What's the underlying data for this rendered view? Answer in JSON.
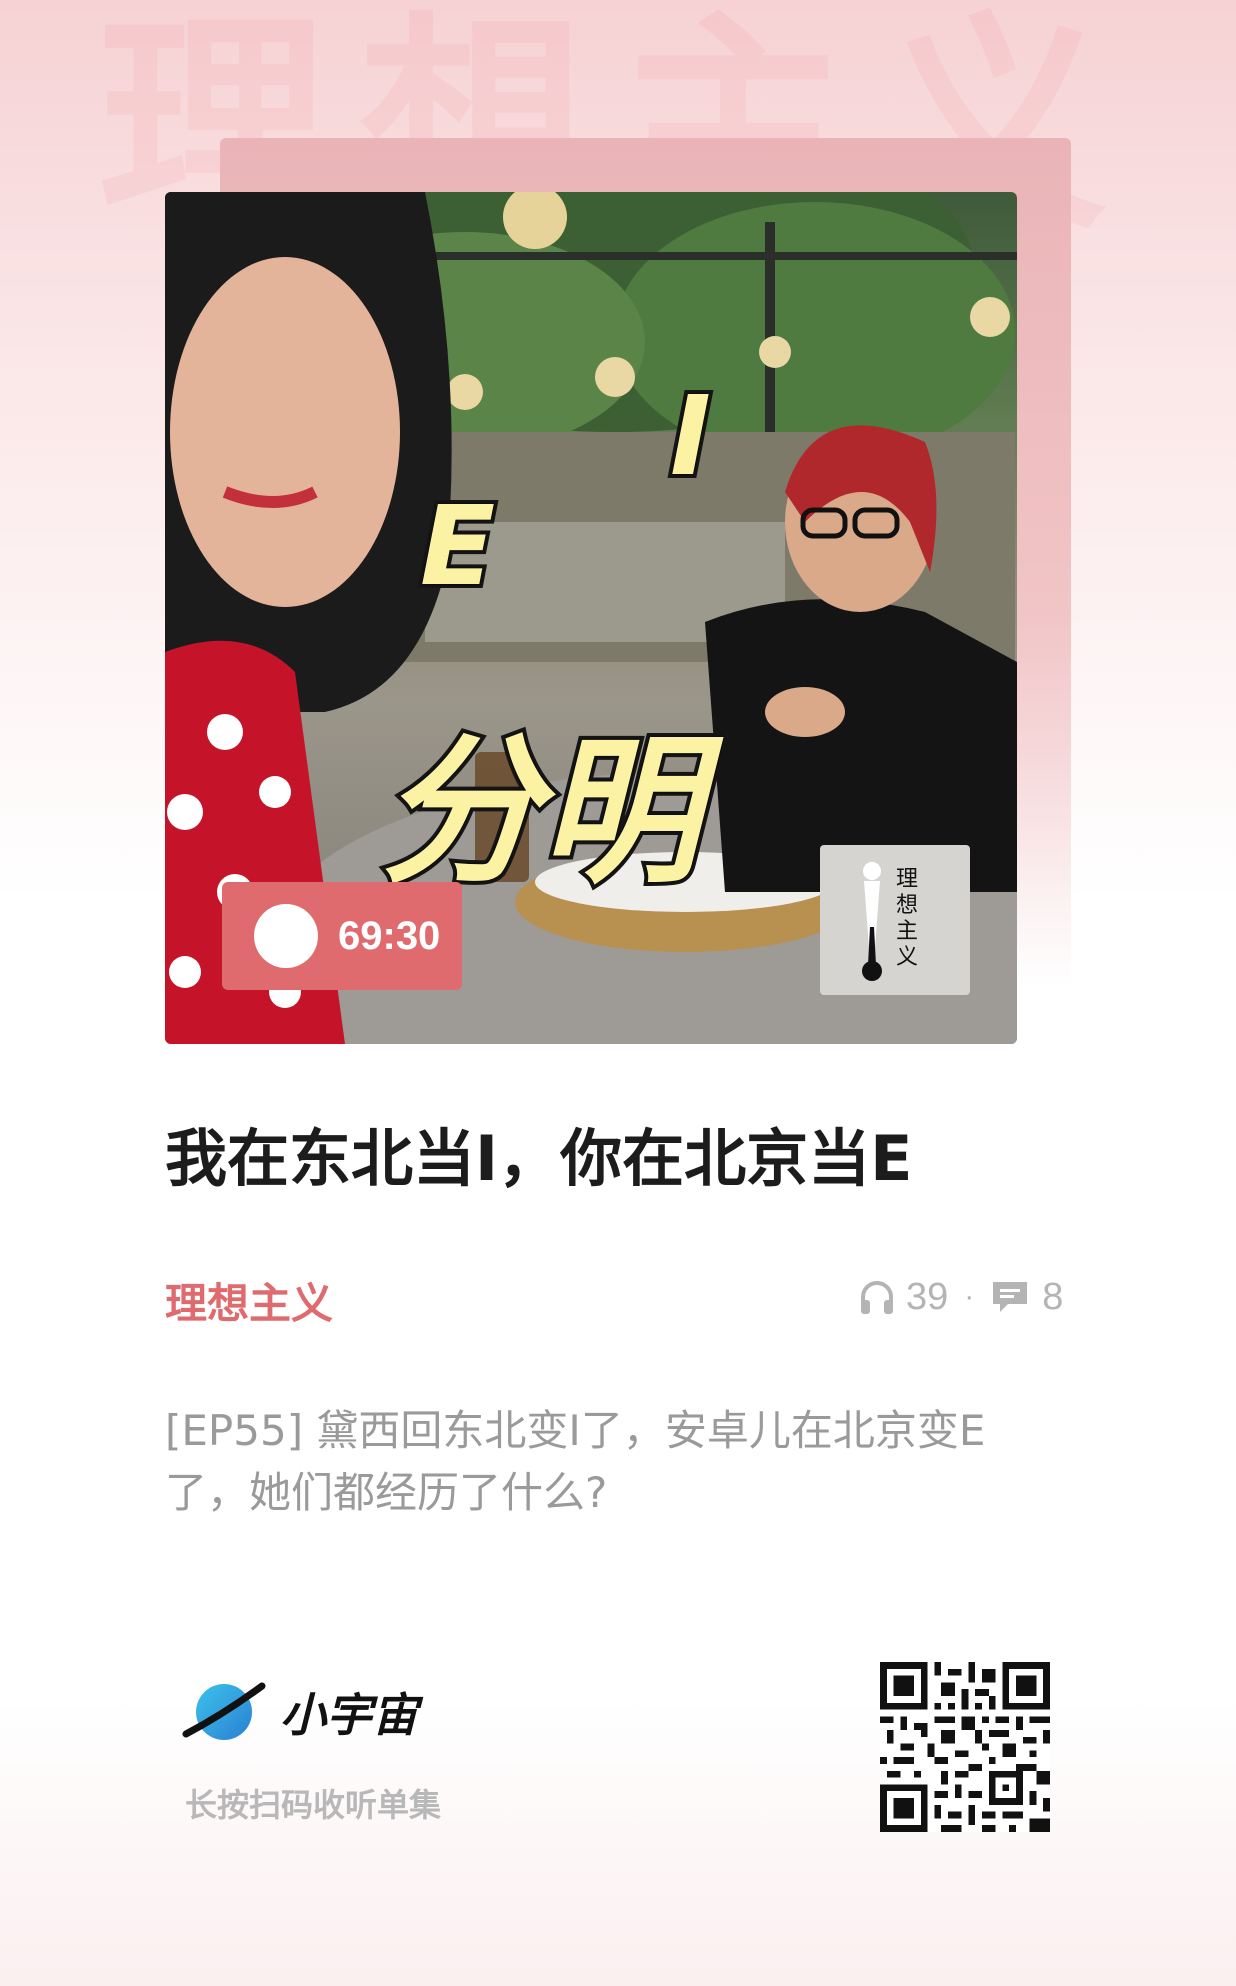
{
  "watermark": "理想主义",
  "cover": {
    "text_e": "E",
    "text_i": "I",
    "text_big": "分明",
    "duration": "69:30",
    "logo_vertical_text": "理想主义"
  },
  "episode": {
    "title": "我在东北当I，你在北京当E",
    "podcast_name": "理想主义",
    "listens": "39",
    "separator": "·",
    "comments": "8",
    "description": "[EP55] 黛西回东北变I了，安卓儿在北京变E了，她们都经历了什么?"
  },
  "footer": {
    "brand": "小宇宙",
    "hint": "长按扫码收听单集"
  },
  "colors": {
    "accent": "#df6b6e",
    "title": "#1c1c1c",
    "muted": "#9a9a9a"
  },
  "icons": [
    "play-icon",
    "headphones-icon",
    "comment-icon",
    "planet-logo-icon",
    "qr-code"
  ]
}
